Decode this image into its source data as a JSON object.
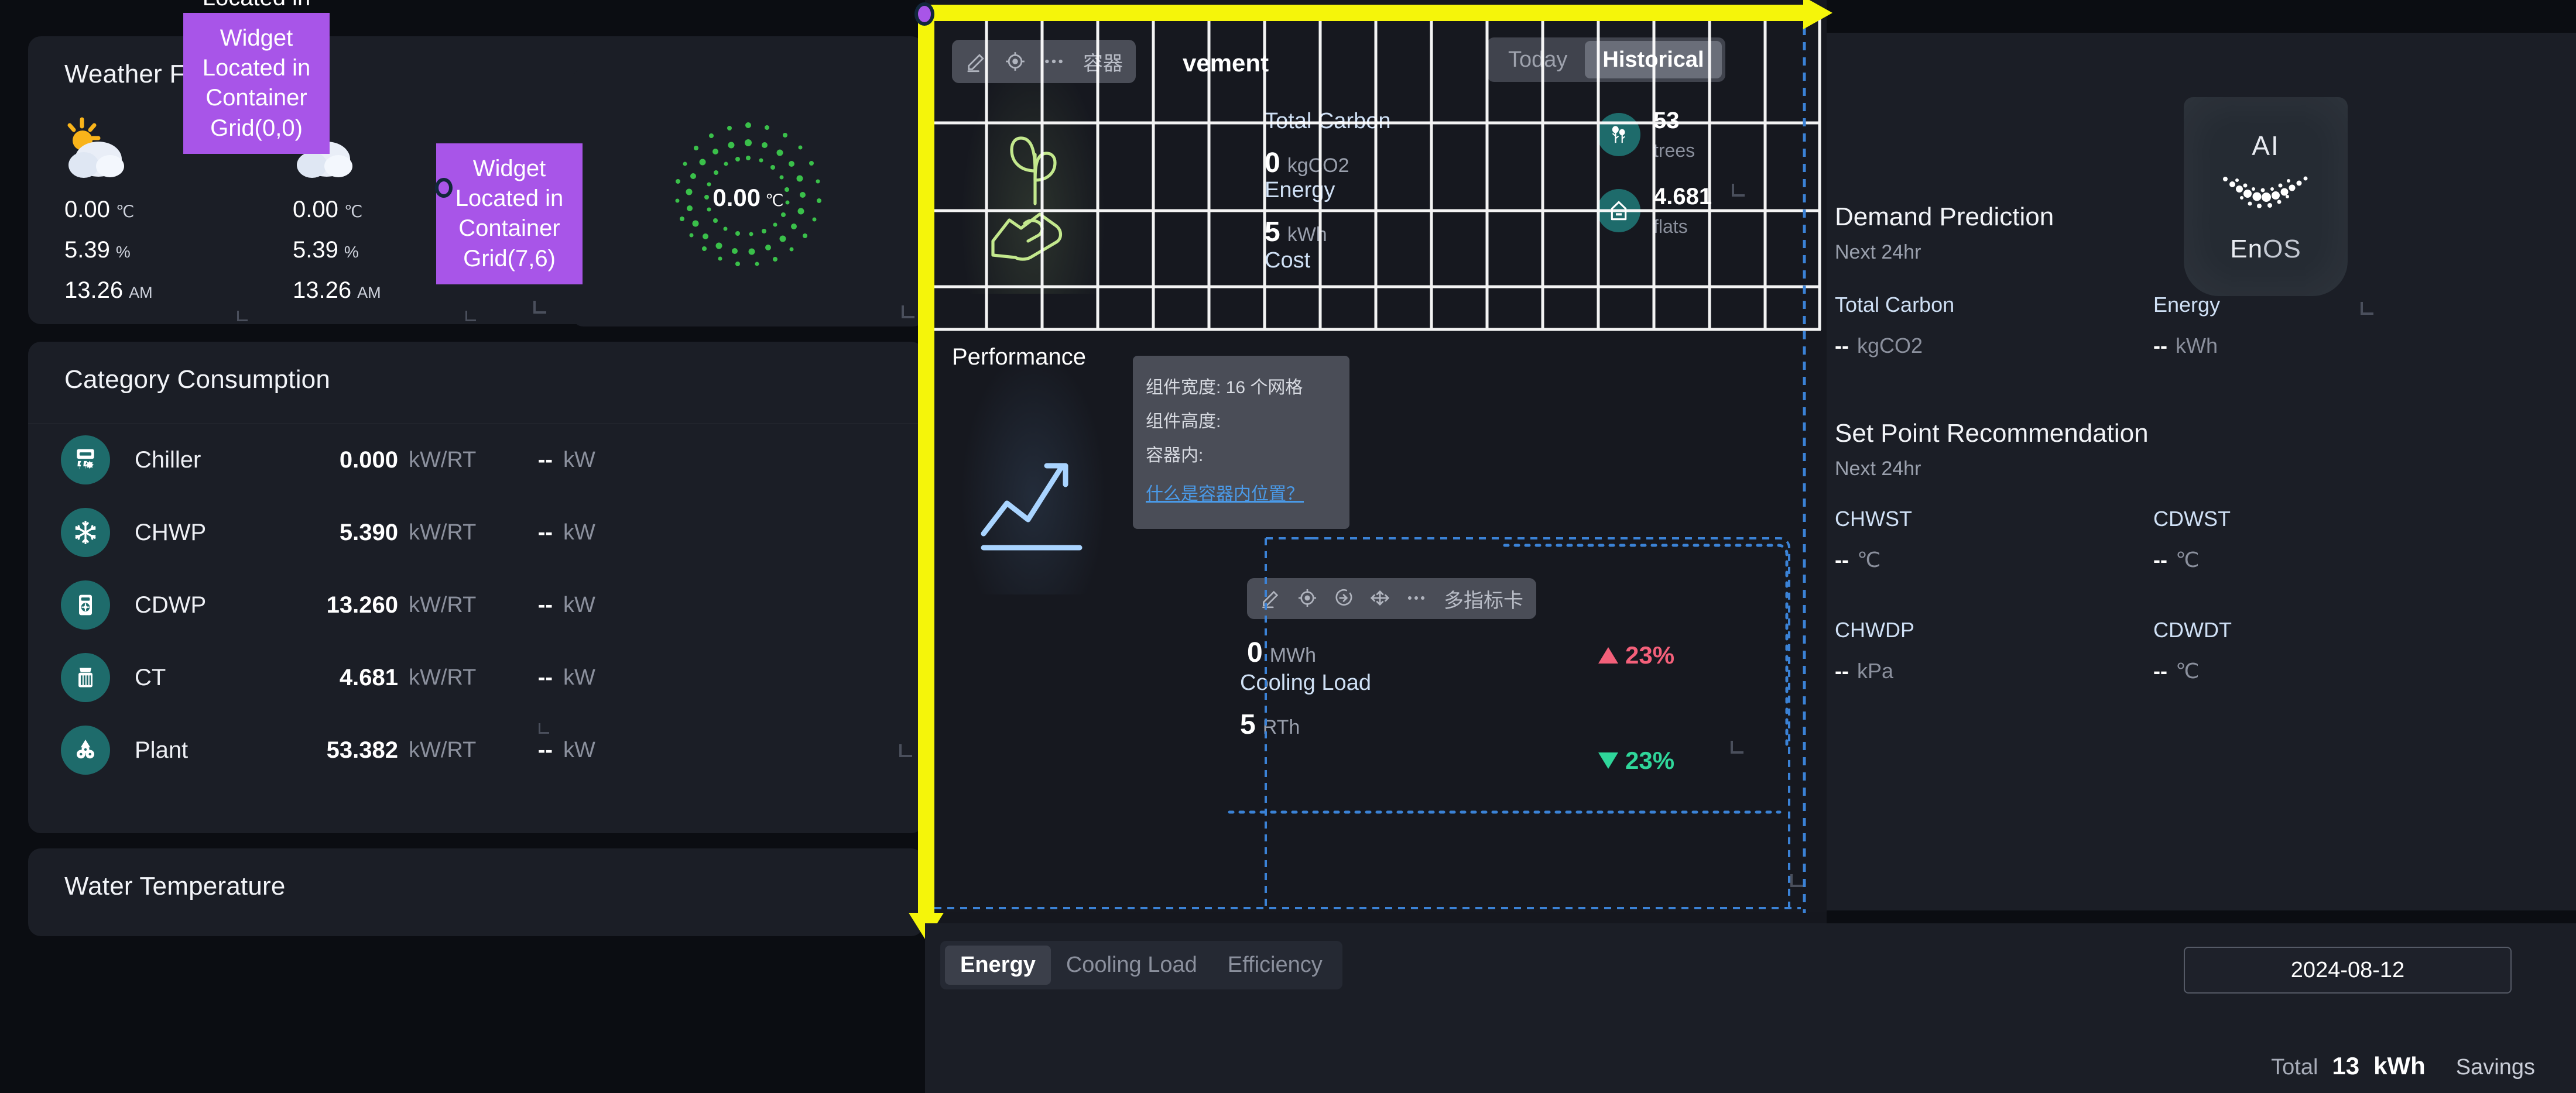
{
  "left": {
    "weather": {
      "title": "Weather Forecast",
      "icon": "sun-behind-cloud-icon",
      "forecasts": [
        {
          "temp": "0.00",
          "temp_unit": "℃",
          "humidity": "5.39",
          "humidity_unit": "%",
          "time": "13.26",
          "meridiem": "AM"
        },
        {
          "temp": "0.00",
          "temp_unit": "℃",
          "humidity": "5.39",
          "humidity_unit": "%",
          "time": "13.26",
          "meridiem": "AM"
        }
      ],
      "gauge": {
        "value": "0.00",
        "unit": "℃",
        "color": "#3ac04a"
      }
    },
    "category": {
      "title": "Category Consumption",
      "rows": [
        {
          "icon": "chiller-icon",
          "name": "Chiller",
          "value": "0.000",
          "unit": "kW/RT",
          "power": "--",
          "power_unit": "kW"
        },
        {
          "icon": "snowflake-icon",
          "name": "CHWP",
          "value": "5.390",
          "unit": "kW/RT",
          "power": "--",
          "power_unit": "kW"
        },
        {
          "icon": "pump-icon",
          "name": "CDWP",
          "value": "13.260",
          "unit": "kW/RT",
          "power": "--",
          "power_unit": "kW"
        },
        {
          "icon": "cooling-tower-icon",
          "name": "CT",
          "value": "4.681",
          "unit": "kW/RT",
          "power": "--",
          "power_unit": "kW"
        },
        {
          "icon": "plant-icon",
          "name": "Plant",
          "value": "53.382",
          "unit": "kW/RT",
          "power": "--",
          "power_unit": "kW"
        }
      ]
    },
    "water_temperature": {
      "title": "Water Temperature"
    }
  },
  "center": {
    "toolbar_top": {
      "icons": [
        "pencil-icon",
        "target-icon",
        "more-icon"
      ],
      "label": "容器"
    },
    "widget_title": "vement",
    "segments": {
      "items": [
        {
          "label": "Today",
          "active": false
        },
        {
          "label": "Historical",
          "active": true
        }
      ]
    },
    "kpis": [
      {
        "label": "Total Carbon",
        "value": "0",
        "unit": "kgCO2"
      },
      {
        "label": "Energy",
        "value": "5",
        "unit": "kWh"
      },
      {
        "label": "Cost",
        "value": "",
        "unit": ""
      }
    ],
    "side_stats": [
      {
        "icon": "trees-icon",
        "value": "53",
        "unit": "trees"
      },
      {
        "icon": "flats-icon",
        "value": "4.681",
        "unit": "flats"
      }
    ],
    "performance_title": "Performance",
    "perf_toolbar": {
      "icons": [
        "pencil-icon",
        "target-icon",
        "enter-icon",
        "move-icon",
        "more-icon"
      ],
      "label": "多指标卡"
    },
    "perf_kpis": [
      {
        "label": "",
        "value": "0",
        "unit": "MWh",
        "delta": "23%",
        "direction": "up"
      },
      {
        "label": "Cooling Load",
        "value": "5",
        "unit": "RTh",
        "delta": "23%",
        "direction": "down"
      }
    ],
    "tooltip": {
      "line1": "组件宽度: 16 个网格",
      "line2": "组件高度:",
      "line3": "容器内:",
      "link": "什么是容器内位置？"
    }
  },
  "bottom": {
    "tabs": [
      {
        "label": "Energy",
        "active": true
      },
      {
        "label": "Cooling Load",
        "active": false
      },
      {
        "label": "Efficiency",
        "active": false
      }
    ],
    "date": "2024-08-12",
    "total_label": "Total",
    "total_value": "13",
    "total_unit": "kWh",
    "savings_label": "Savings"
  },
  "right": {
    "ai_card": {
      "top": "AI",
      "bottom_bold": "En",
      "bottom_dim": "OS",
      "icon": "enos-smile-icon"
    },
    "demand": {
      "title": "Demand Prediction",
      "subtitle": "Next 24hr",
      "cells": [
        {
          "label": "Total Carbon",
          "value": "--",
          "unit": "kgCO2"
        },
        {
          "label": "Energy",
          "value": "--",
          "unit": "kWh"
        }
      ]
    },
    "setpoint": {
      "title": "Set Point Recommendation",
      "subtitle": "Next 24hr",
      "cells": [
        {
          "label": "CHWST",
          "value": "--",
          "unit": "℃"
        },
        {
          "label": "CDWST",
          "value": "--",
          "unit": "℃"
        },
        {
          "label": "CHWDP",
          "value": "--",
          "unit": "kPa"
        },
        {
          "label": "CDWDT",
          "value": "--",
          "unit": "℃"
        }
      ]
    }
  },
  "annotations": {
    "origin_label": "Widget Located in\nContainer Grid(0,0)",
    "widget_label": "Widget Located in\nContainer Grid(7,6)",
    "accent": "#a855e8",
    "arrow_color": "#f5f50a"
  }
}
